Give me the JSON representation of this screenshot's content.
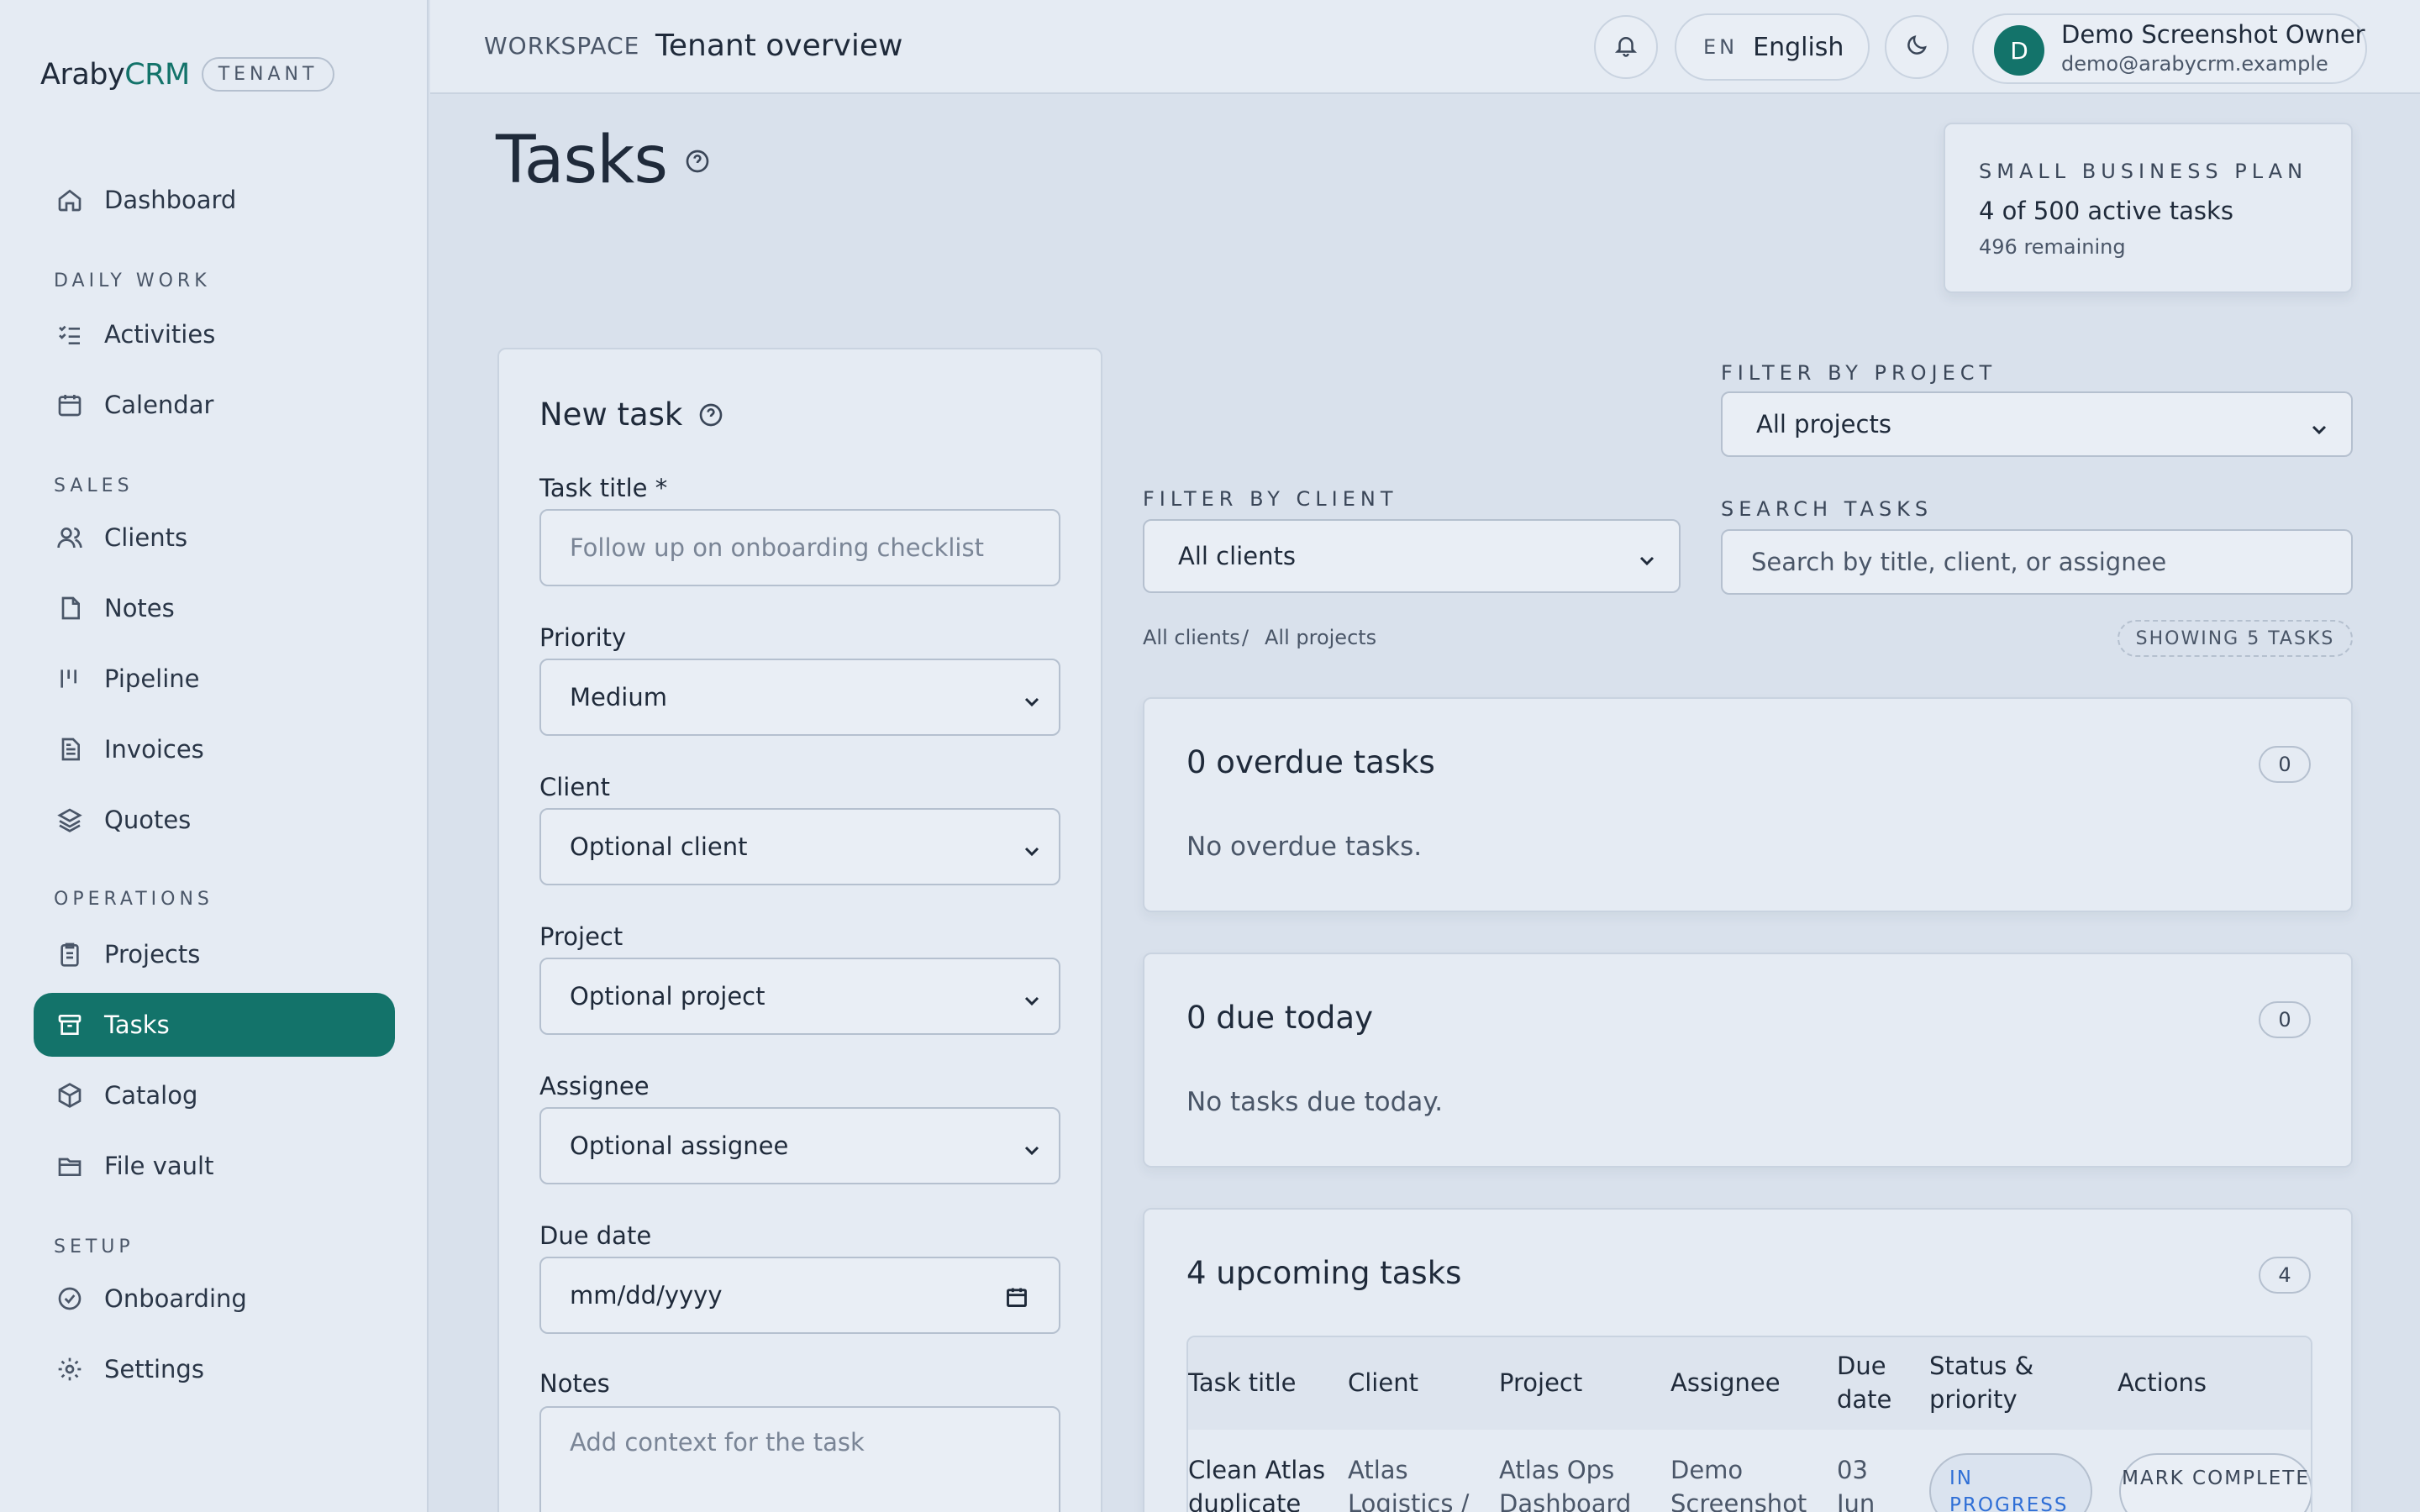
{
  "brand": {
    "name_part1": "Araby",
    "name_part2": "CRM",
    "tenant_badge": "TENANT"
  },
  "sidebar": {
    "items": [
      {
        "label": "Dashboard",
        "icon": "home-icon"
      },
      {
        "label": "Activities",
        "icon": "checklist-icon"
      },
      {
        "label": "Calendar",
        "icon": "calendar-icon"
      },
      {
        "label": "Clients",
        "icon": "users-icon"
      },
      {
        "label": "Notes",
        "icon": "file-icon"
      },
      {
        "label": "Pipeline",
        "icon": "pipeline-icon"
      },
      {
        "label": "Invoices",
        "icon": "invoice-icon"
      },
      {
        "label": "Quotes",
        "icon": "layers-icon"
      },
      {
        "label": "Projects",
        "icon": "clipboard-icon"
      },
      {
        "label": "Tasks",
        "icon": "archive-icon",
        "active": true
      },
      {
        "label": "Catalog",
        "icon": "package-icon"
      },
      {
        "label": "File vault",
        "icon": "folder-icon"
      },
      {
        "label": "Onboarding",
        "icon": "check-circle-icon"
      },
      {
        "label": "Settings",
        "icon": "gear-icon"
      }
    ],
    "sections": [
      "DAILY WORK",
      "SALES",
      "OPERATIONS",
      "SETUP"
    ]
  },
  "topbar": {
    "workspace_label": "WORKSPACE",
    "title": "Tenant overview",
    "lang_code": "EN",
    "lang_name": "English",
    "user": {
      "initial": "D",
      "name": "Demo Screenshot Owner",
      "email": "demo@arabycrm.example"
    }
  },
  "page": {
    "title": "Tasks"
  },
  "plan": {
    "label": "SMALL BUSINESS PLAN",
    "count": "4 of 500 active tasks",
    "remaining": "496 remaining"
  },
  "form": {
    "title": "New task",
    "task_title_label": "Task title *",
    "task_title_placeholder": "Follow up on onboarding checklist",
    "priority_label": "Priority",
    "priority_value": "Medium",
    "client_label": "Client",
    "client_value": "Optional client",
    "project_label": "Project",
    "project_value": "Optional project",
    "assignee_label": "Assignee",
    "assignee_value": "Optional assignee",
    "due_date_label": "Due date",
    "due_date_placeholder": "mm/dd/yyyy",
    "notes_label": "Notes",
    "notes_placeholder": "Add context for the task"
  },
  "filters": {
    "project_label": "FILTER BY PROJECT",
    "project_value": "All projects",
    "client_label": "FILTER BY CLIENT",
    "client_value": "All clients",
    "search_label": "SEARCH TASKS",
    "search_placeholder": "Search by title, client, or assignee"
  },
  "breadcrumb": {
    "clients": "All clients",
    "separator": "/",
    "projects": "All projects"
  },
  "showing": "SHOWING 5 TASKS",
  "overdue": {
    "title": "0 overdue tasks",
    "count": "0",
    "empty": "No overdue tasks."
  },
  "today": {
    "title": "0 due today",
    "count": "0",
    "empty": "No tasks due today."
  },
  "upcoming": {
    "title": "4 upcoming tasks",
    "count": "4",
    "headers": [
      "Task title",
      "Client",
      "Project",
      "Assignee",
      "Due date",
      "Status & priority",
      "Actions"
    ],
    "row": {
      "title": "Clean Atlas duplicate",
      "client": "Atlas Logistics /",
      "project": "Atlas Ops Dashboard",
      "assignee": "Demo Screenshot",
      "due": "03 Jun",
      "status": "IN PROGRESS",
      "action": "MARK COMPLETE"
    }
  },
  "colors": {
    "accent": "#13736a",
    "status_blue": "#2f6fd6",
    "background": "#d9e1ec"
  }
}
